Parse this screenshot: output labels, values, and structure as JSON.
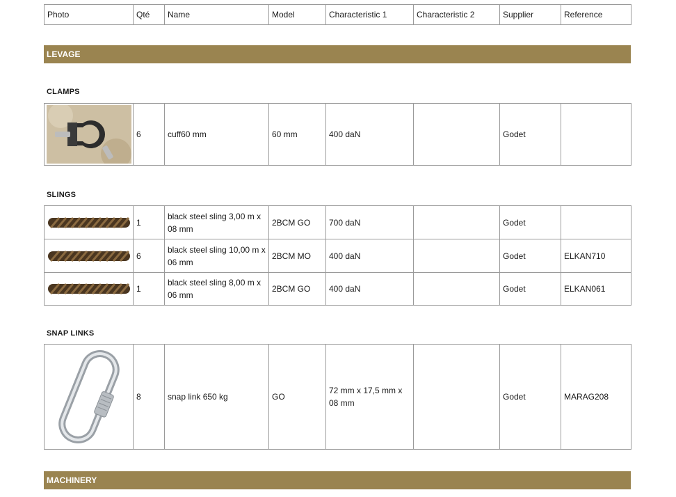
{
  "headers": [
    "Photo",
    "Qté",
    "Name",
    "Model",
    "Characteristic 1",
    "Characteristic 2",
    "Supplier",
    "Reference"
  ],
  "sections": [
    {
      "title": "LEVAGE",
      "groups": [
        {
          "title": "CLAMPS",
          "rows": [
            {
              "photo": "clamp-photo",
              "qty": "6",
              "name": "cuff60 mm",
              "model": "60 mm",
              "char1": "400 daN",
              "char2": "",
              "supplier": "Godet",
              "reference": ""
            }
          ]
        },
        {
          "title": "SLINGS",
          "rows": [
            {
              "photo": "steel-sling-photo",
              "qty": "1",
              "name": "black steel sling 3,00 m x 08 mm",
              "model": "2BCM GO",
              "char1": "700 daN",
              "char2": "",
              "supplier": "Godet",
              "reference": ""
            },
            {
              "photo": "steel-sling-photo",
              "qty": "6",
              "name": "black steel sling 10,00 m x 06 mm",
              "model": "2BCM MO",
              "char1": "400 daN",
              "char2": "",
              "supplier": "Godet",
              "reference": "ELKAN710"
            },
            {
              "photo": "steel-sling-photo",
              "qty": "1",
              "name": "black steel sling 8,00 m x 06 mm",
              "model": "2BCM GO",
              "char1": "400 daN",
              "char2": "",
              "supplier": "Godet",
              "reference": "ELKAN061"
            }
          ]
        },
        {
          "title": "SNAP LINKS",
          "rows": [
            {
              "photo": "snap-link-photo",
              "qty": "8",
              "name": "snap link 650 kg",
              "model": "GO",
              "char1": "72 mm x 17,5 mm x 08 mm",
              "char2": "",
              "supplier": "Godet",
              "reference": "MARAG208"
            }
          ]
        }
      ]
    },
    {
      "title": "MACHINERY",
      "groups": []
    }
  ]
}
